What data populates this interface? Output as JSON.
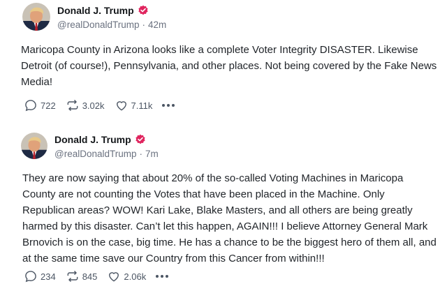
{
  "posts": [
    {
      "author": {
        "display_name": "Donald J. Trump",
        "handle": "@realDonaldTrump",
        "time": "42m",
        "verified_color": "#e0245e"
      },
      "text": "Maricopa County in Arizona looks like a complete Voter Integrity DISASTER. Likewise Detroit (of course!), Pennsylvania, and other places. Not being covered by the Fake News Media!",
      "stats": {
        "replies": "722",
        "reposts": "3.02k",
        "likes": "7.11k"
      }
    },
    {
      "author": {
        "display_name": "Donald J. Trump",
        "handle": "@realDonaldTrump",
        "time": "7m",
        "verified_color": "#e0245e"
      },
      "text": "They are now saying that about 20% of the so-called Voting Machines in Maricopa County are not counting the Votes that have been placed in the Machine. Only Republican areas? WOW! Kari Lake, Blake Masters, and all others are being greatly harmed by this disaster. Can’t let this happen, AGAIN!!! I believe Attorney General Mark Brnovich is on the case, big time. He has a chance to be the biggest hero of them all, and at the same time save our Country from this Cancer from within!!!",
      "stats": {
        "replies": "234",
        "reposts": "845",
        "likes": "2.06k"
      }
    }
  ],
  "icons": {
    "reply": "speech-bubble-icon",
    "repost": "repost-arrows-icon",
    "like": "heart-icon",
    "more": "ellipsis-icon",
    "verified": "verified-badge-icon"
  }
}
